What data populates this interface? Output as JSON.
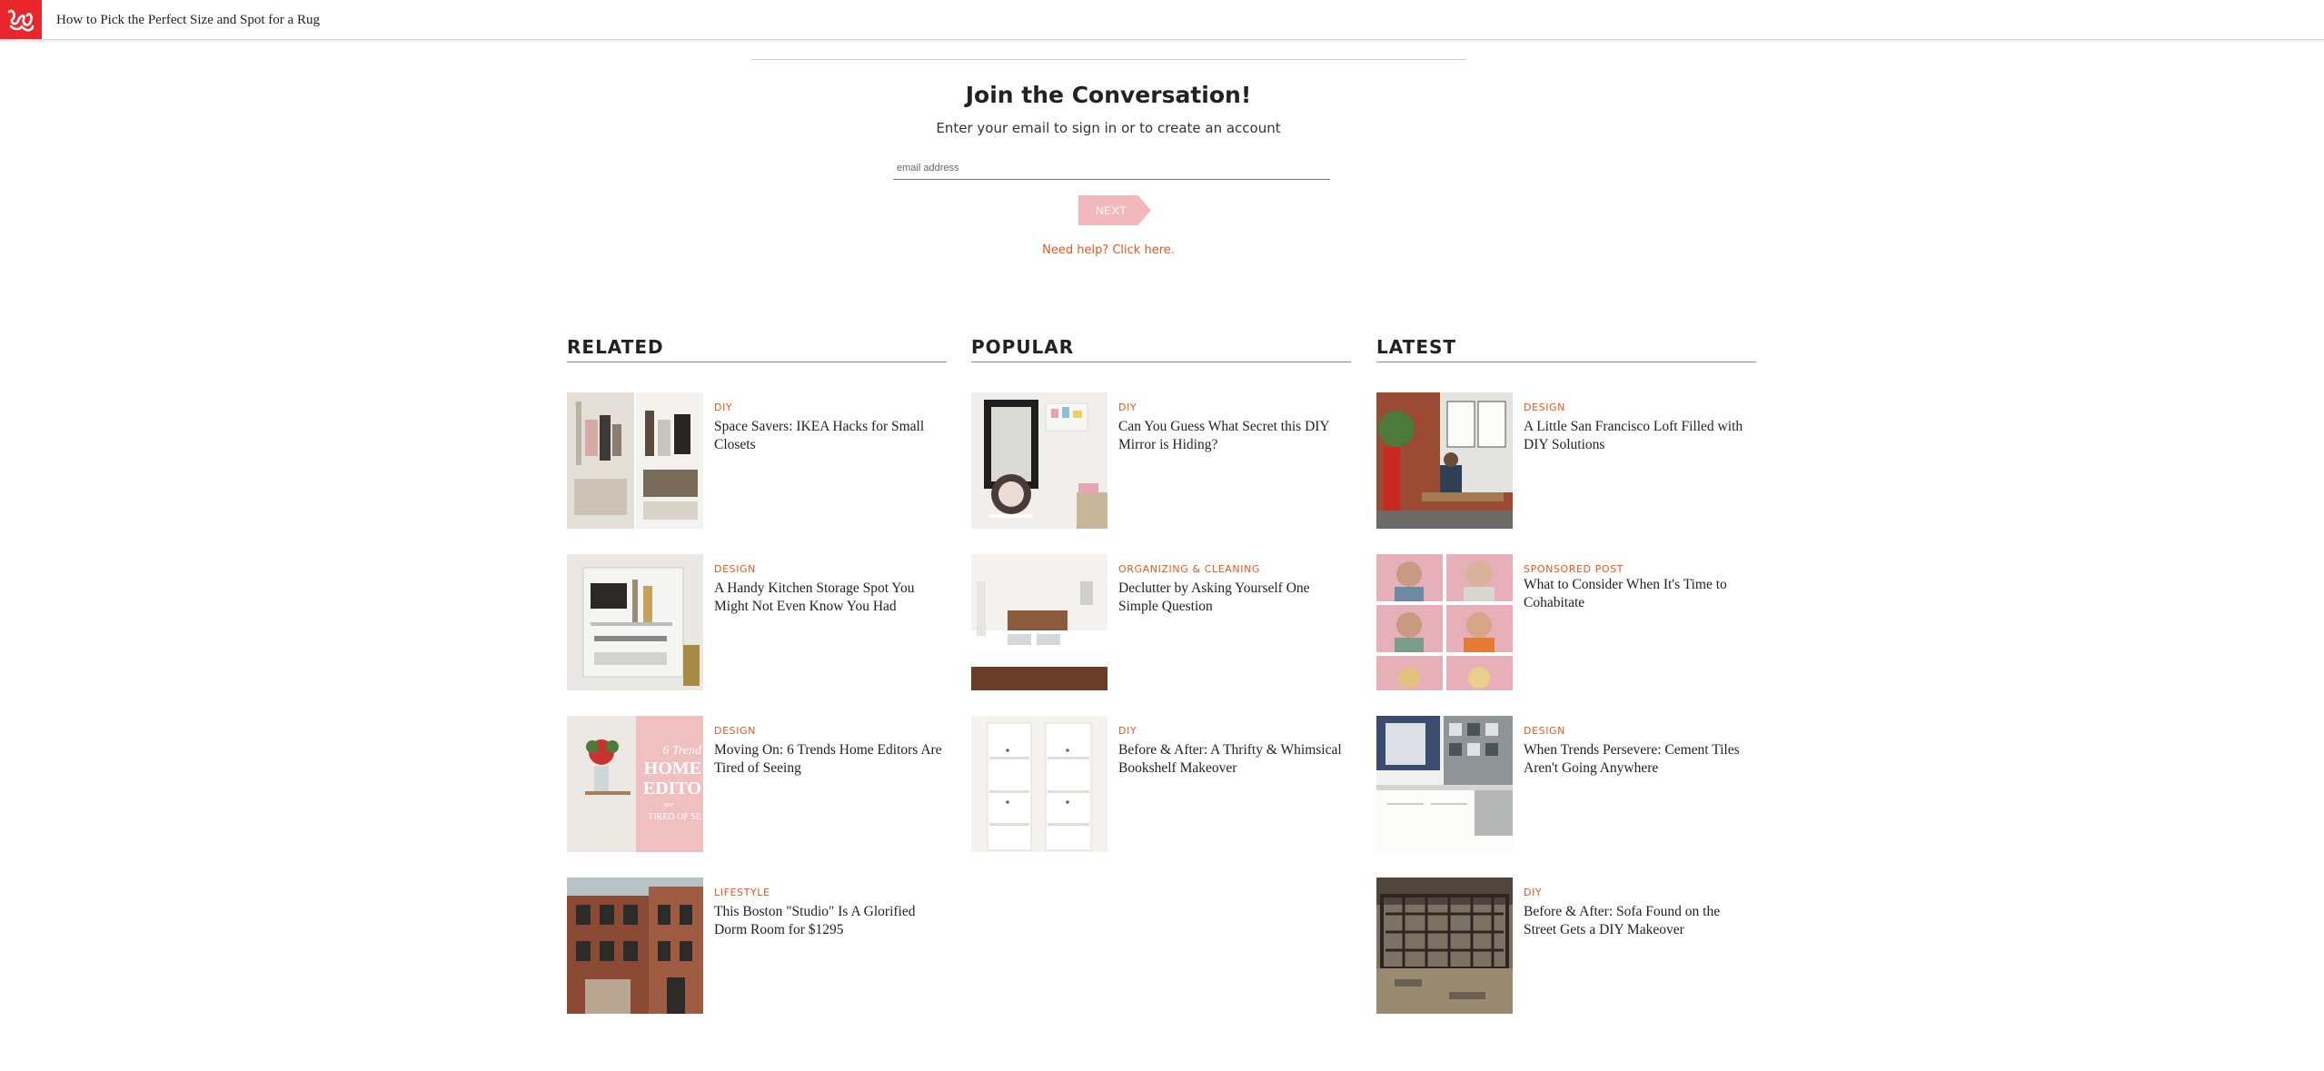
{
  "header": {
    "logo_icon": "apartment-therapy-logo",
    "brand_color": "#e8262b",
    "article_title": "How to Pick the Perfect Size and Spot for a Rug"
  },
  "signup": {
    "heading": "Join the Conversation!",
    "subheading": "Enter your email to sign in or to create an account",
    "email_placeholder": "email address",
    "email_value": "",
    "next_label": "NEXT",
    "help_link": "Need help? Click here.",
    "accent_color": "#e05a23"
  },
  "related": {
    "heading": "RELATED",
    "items": [
      {
        "category": "DIY",
        "title": "Space Savers: IKEA Hacks for Small Closets"
      },
      {
        "category": "DESIGN",
        "title": "A Handy Kitchen Storage Spot You Might Not Even Know You Had"
      },
      {
        "category": "DESIGN",
        "title": "Moving On: 6 Trends Home Editors Are Tired of Seeing",
        "thumb_text": [
          "6 Trend",
          "HOME",
          "EDITO",
          "are",
          "TIRED OF SE"
        ]
      },
      {
        "category": "LIFESTYLE",
        "title": "This Boston \"Studio\" Is A Glorified Dorm Room for $1295"
      }
    ]
  },
  "popular": {
    "heading": "POPULAR",
    "items": [
      {
        "category": "DIY",
        "title": "Can You Guess What Secret this DIY Mirror is Hiding?"
      },
      {
        "category": "ORGANIZING & CLEANING",
        "title": "Declutter by Asking Yourself One Simple Question"
      },
      {
        "category": "DIY",
        "title": "Before & After: A Thrifty & Whimsical Bookshelf Makeover"
      }
    ]
  },
  "latest": {
    "heading": "LATEST",
    "items": [
      {
        "category": "DESIGN",
        "title": "A Little San Francisco Loft Filled with DIY Solutions"
      },
      {
        "category": "SPONSORED POST",
        "title": "What to Consider When It's Time to Cohabitate"
      },
      {
        "category": "DESIGN",
        "title": "When Trends Persevere: Cement Tiles Aren't Going Anywhere"
      },
      {
        "category": "DIY",
        "title": "Before & After: Sofa Found on the Street Gets a DIY Makeover"
      }
    ]
  }
}
